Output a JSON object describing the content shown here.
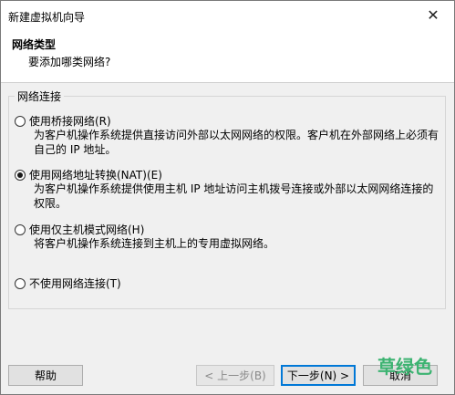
{
  "window": {
    "title": "新建虚拟机向导",
    "close_glyph": "✕"
  },
  "header": {
    "title": "网络类型",
    "subtitle": "要添加哪类网络?"
  },
  "group": {
    "legend": "网络连接"
  },
  "options": [
    {
      "label": "使用桥接网络(R)",
      "desc": "为客户机操作系统提供直接访问外部以太网网络的权限。客户机在外部网络上必须有自己的 IP 地址。",
      "checked": false
    },
    {
      "label": "使用网络地址转换(NAT)(E)",
      "desc": "为客户机操作系统提供使用主机 IP 地址访问主机拨号连接或外部以太网网络连接的权限。",
      "checked": true
    },
    {
      "label": "使用仅主机模式网络(H)",
      "desc": "将客户机操作系统连接到主机上的专用虚拟网络。",
      "checked": false
    },
    {
      "label": "不使用网络连接(T)",
      "desc": "",
      "checked": false
    }
  ],
  "footer": {
    "help": "帮助",
    "back": "< 上一步(B)",
    "next": "下一步(N) >",
    "cancel": "取消"
  },
  "watermark": "草绿色"
}
